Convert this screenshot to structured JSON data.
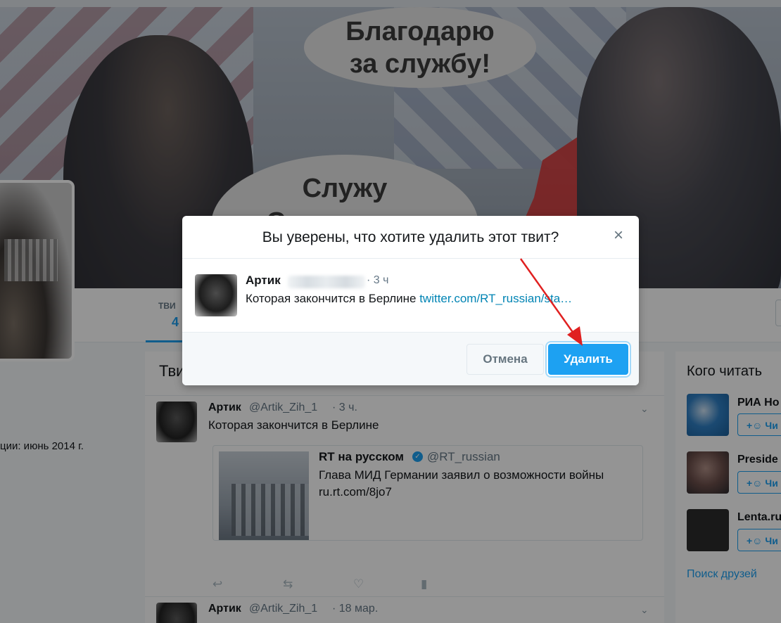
{
  "header": {
    "bubble_top": "Благодарю\nза службу!",
    "bubble_bottom": "Служу\nСоветскому"
  },
  "profile": {
    "joined_text": "ции: июнь 2014 г."
  },
  "nav": {
    "tab_label": "ТВИ",
    "tab_count": "4"
  },
  "timeline": {
    "title": "Тви",
    "tweets": [
      {
        "name": "Артик",
        "handle": "@Artik_Zih_1",
        "time": "· 3 ч.",
        "text": "Которая закончится в Берлине",
        "quote": {
          "name": "RT на русском",
          "handle": "@RT_russian",
          "text": "Глава МИД Германии заявил о возможности войны",
          "link": "ru.rt.com/8jo7"
        }
      },
      {
        "name": "Артик",
        "handle": "@Artik_Zih_1",
        "time": "· 18 мар."
      }
    ]
  },
  "who_to_follow": {
    "title": "Кого читать",
    "items": [
      {
        "name": "РИА Но",
        "follow": "Чи",
        "color": "#2f7fc4"
      },
      {
        "name": "Preside",
        "follow": "Чи",
        "color": "#6b4e4a"
      },
      {
        "name": "Lenta.ru",
        "follow": "Чи",
        "color": "#2b2b2b"
      }
    ],
    "find_friends": "Поиск друзей"
  },
  "modal": {
    "title": "Вы уверены, что хотите удалить этот твит?",
    "close": "×",
    "tweet": {
      "name": "Артик",
      "time": "· 3 ч",
      "text": "Которая закончится в Берлине",
      "link": "twitter.com/RT_russian/sta…"
    },
    "cancel_label": "Отмена",
    "delete_label": "Удалить"
  },
  "colors": {
    "accent": "#1da1f2",
    "annotation": "#e02020"
  }
}
